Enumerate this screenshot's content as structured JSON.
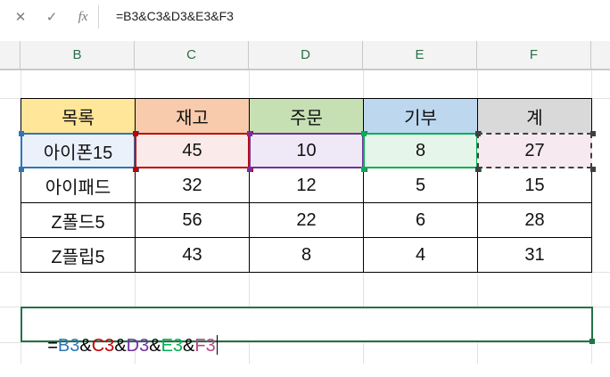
{
  "formula_bar": {
    "cancel_icon": "close-icon",
    "enter_icon": "check-icon",
    "function_icon": "fx-icon",
    "fx_label": "fx",
    "formula": "=B3&C3&D3&E3&F3"
  },
  "columns": [
    "B",
    "C",
    "D",
    "E",
    "F"
  ],
  "table": {
    "headers": [
      "목록",
      "재고",
      "주문",
      "기부",
      "계"
    ],
    "header_colors": [
      "#ffe699",
      "#f8cbad",
      "#c6e0b4",
      "#bdd7ee",
      "#d9d9d9"
    ],
    "rows": [
      [
        "아이폰15",
        "45",
        "10",
        "8",
        "27"
      ],
      [
        "아이패드",
        "32",
        "12",
        "5",
        "15"
      ],
      [
        "Z폴드5",
        "56",
        "22",
        "6",
        "28"
      ],
      [
        "Z플립5",
        "43",
        "8",
        "4",
        "31"
      ]
    ]
  },
  "active_formula": {
    "eq": "=",
    "parts": [
      {
        "ref": "B3",
        "color": "#2e75b6"
      },
      {
        "ref": "C3",
        "color": "#c00000"
      },
      {
        "ref": "D3",
        "color": "#7030a0"
      },
      {
        "ref": "E3",
        "color": "#00b050"
      },
      {
        "ref": "F3",
        "color": "#b04a88"
      }
    ],
    "amp": "&"
  },
  "highlight_colors": {
    "B3": "#2e75b6",
    "C3": "#c00000",
    "D3": "#7030a0",
    "E3": "#00b050",
    "F3": "#404040"
  }
}
